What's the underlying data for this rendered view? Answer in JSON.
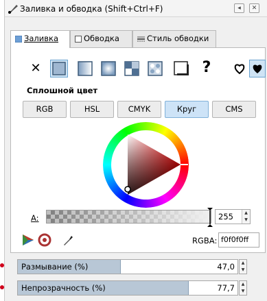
{
  "window": {
    "title": "Заливка и обводка (Shift+Ctrl+F)",
    "buttons": [
      "◂",
      "✕"
    ]
  },
  "tabs": [
    {
      "label": "Заливка",
      "active": true
    },
    {
      "label": "Обводка",
      "active": false
    },
    {
      "label": "Стиль обводки",
      "active": false
    }
  ],
  "fill_types": [
    "none",
    "flat",
    "linear",
    "radial",
    "pattern",
    "mesh",
    "swatch",
    "unset"
  ],
  "unset_symbol": "?",
  "section_label": "Сплошной цвет",
  "color_modes": [
    {
      "label": "RGB",
      "active": false
    },
    {
      "label": "HSL",
      "active": false
    },
    {
      "label": "CMYK",
      "active": false
    },
    {
      "label": "Круг",
      "active": true
    },
    {
      "label": "CMS",
      "active": false
    }
  ],
  "alpha": {
    "label": "A:",
    "value": "255"
  },
  "rgba": {
    "label": "RGBA:",
    "value": "f0f0f0ff"
  },
  "blur": {
    "label": "Размывание (%)",
    "value": "47,0",
    "fraction": 0.47
  },
  "opacity": {
    "label": "Непрозрачность (%)",
    "value": "77,7",
    "fraction": 0.777
  },
  "colors": {
    "accent": "#cde3f7",
    "marker": "#d0021b"
  }
}
